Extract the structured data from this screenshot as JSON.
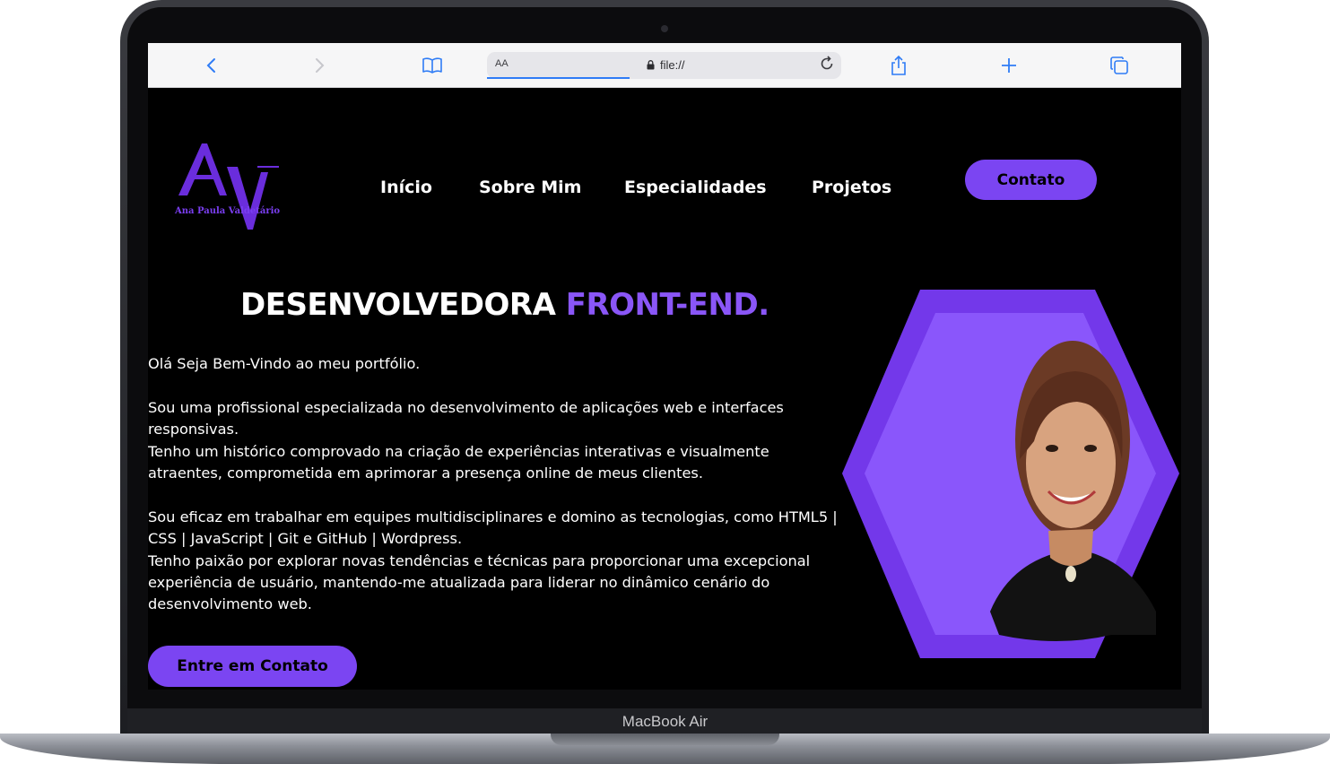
{
  "device": {
    "label": "MacBook Air"
  },
  "browser": {
    "address_aa": "AA",
    "url": "file://",
    "icons": [
      "back-icon",
      "forward-icon",
      "bookmarks-icon",
      "lock-icon",
      "reload-icon",
      "share-icon",
      "new-tab-icon",
      "tabs-icon"
    ]
  },
  "site": {
    "logo": {
      "monogram": "AV",
      "name": "Ana Paula Valdetário"
    },
    "nav": [
      "Início",
      "Sobre Mim",
      "Especialidades",
      "Projetos"
    ],
    "contact_button": "Contato",
    "headline": {
      "white": "DESENVOLVEDORA ",
      "accent": "FRONT-END."
    },
    "paragraphs": [
      "Olá Seja Bem-Vindo ao meu portfólio.",
      "Sou uma profissional especializada no desenvolvimento de aplicações web e interfaces responsivas.",
      "Tenho um histórico comprovado na criação de experiências interativas e visualmente atraentes, comprometida em aprimorar a presença online de meus clientes.",
      "Sou eficaz em trabalhar em equipes multidisciplinares e domino as tecnologias, como HTML5 | CSS | JavaScript | Git e GitHub | Wordpress.",
      "Tenho paixão por explorar novas tendências e técnicas para proporcionar uma excepcional experiência de usuário, mantendo-me atualizada para liderar no dinâmico cenário do desenvolvimento web."
    ],
    "cta_button": "Entre em Contato",
    "colors": {
      "accent": "#7b45f2",
      "accent_light": "#8a56f7",
      "background": "#000000"
    }
  }
}
